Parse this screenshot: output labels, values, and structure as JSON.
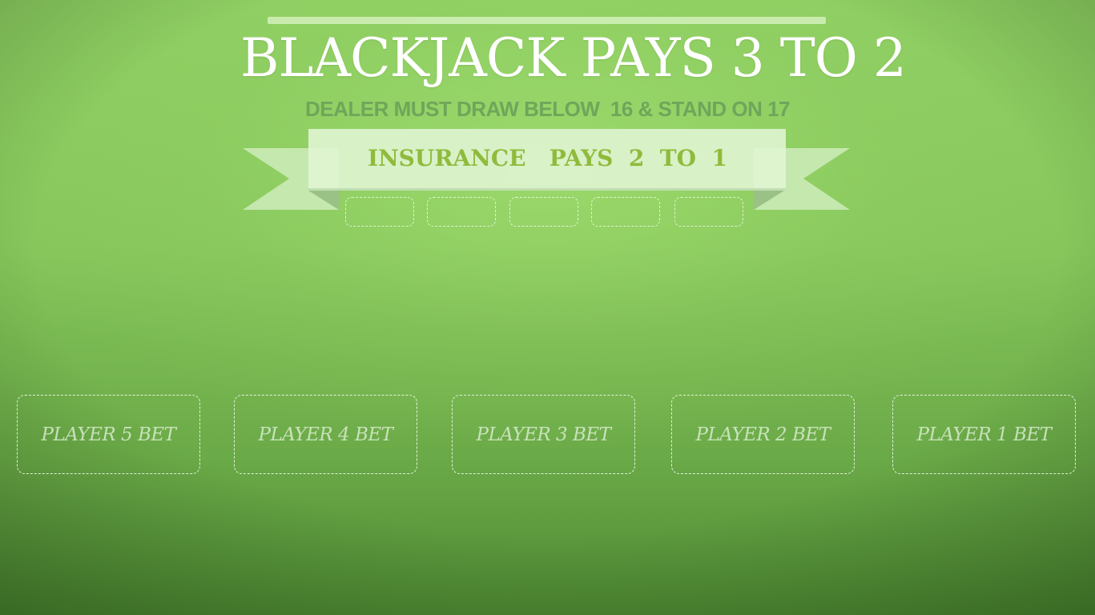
{
  "table": {
    "title": "BLACKJACK  PAYS 3 TO 2",
    "dealer_rule": "DEALER MUST DRAW BELOW  16 & STAND ON 17",
    "insurance_banner": "INSURANCE   PAYS  2  TO  1",
    "insurance_spots": 5
  },
  "bets": [
    {
      "label": "PLAYER 5 BET"
    },
    {
      "label": "PLAYER 4 BET"
    },
    {
      "label": "PLAYER 3 BET"
    },
    {
      "label": "PLAYER 2 BET"
    },
    {
      "label": "PLAYER 1 BET"
    }
  ],
  "colors": {
    "felt": "#86c65b",
    "title_text": "#ffffff",
    "subtitle_text": "#6fa65a",
    "banner_text": "#8fbb3c"
  }
}
